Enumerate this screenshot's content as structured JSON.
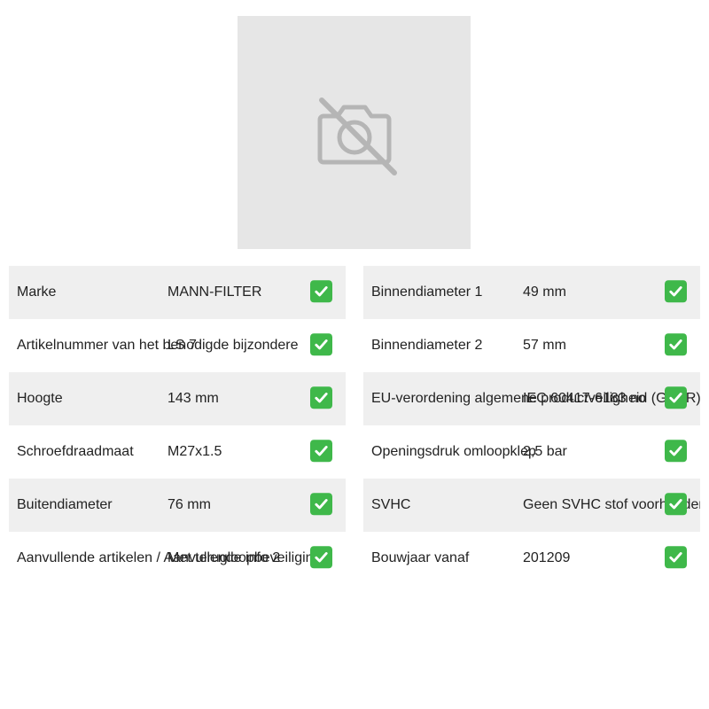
{
  "image": {
    "icon": "camera-off-icon",
    "background": "#e6e6e6"
  },
  "specs_left": [
    {
      "label": "Marke",
      "value": "MANN-FILTER",
      "icon": "check-icon"
    },
    {
      "label": "Artikelnummer van het benodigde bijzondere",
      "value": "LS 7",
      "icon": "check-icon"
    },
    {
      "label": "Hoogte",
      "value": "143 mm",
      "icon": "check-icon"
    },
    {
      "label": "Schroefdraadmaat",
      "value": "M27x1.5",
      "icon": "check-icon"
    },
    {
      "label": "Buitendiameter",
      "value": "76 mm",
      "icon": "check-icon"
    },
    {
      "label": "Aanvullende artikelen / Aanvullende info 2",
      "value": "Met terugloopbeveiliging",
      "icon": "check-icon"
    }
  ],
  "specs_right": [
    {
      "label": "Binnendiameter 1",
      "value": "49 mm",
      "icon": "check-icon"
    },
    {
      "label": "Binnendiameter 2",
      "value": "57 mm",
      "icon": "check-icon"
    },
    {
      "label": "EU-verordening algemene productveiligheid (GPSR)",
      "value": "IEC 60417-6183 no",
      "icon": "check-icon"
    },
    {
      "label": "Openingsdruk omloopklep",
      "value": "2,5 bar",
      "icon": "check-icon"
    },
    {
      "label": "SVHC",
      "value": "Geen SVHC stof voorhanden",
      "icon": "check-icon"
    },
    {
      "label": "Bouwjaar vanaf",
      "value": "201209",
      "icon": "check-icon"
    }
  ],
  "colors": {
    "row_shade": "#efefef",
    "check_green": "#3fb84a"
  }
}
